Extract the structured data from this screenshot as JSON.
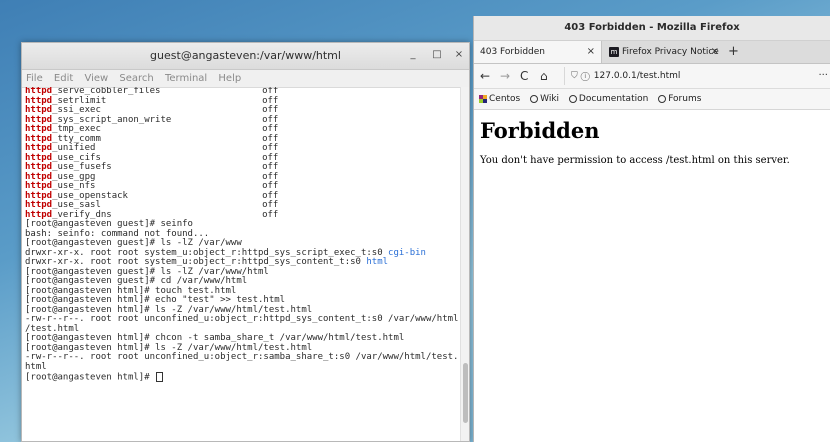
{
  "terminal": {
    "title": "guest@angasteven:/var/www/html",
    "menu": [
      "File",
      "Edit",
      "View",
      "Search",
      "Terminal",
      "Help"
    ],
    "controls": {
      "minimize": "_",
      "maximize": "□",
      "close": "×"
    },
    "bool_rows": [
      {
        "prefix": "httpd",
        "name": "_serve_cobbler_files",
        "value": "off"
      },
      {
        "prefix": "httpd",
        "name": "_setrlimit",
        "value": "off"
      },
      {
        "prefix": "httpd",
        "name": "_ssi_exec",
        "value": "off"
      },
      {
        "prefix": "httpd",
        "name": "_sys_script_anon_write",
        "value": "off"
      },
      {
        "prefix": "httpd",
        "name": "_tmp_exec",
        "value": "off"
      },
      {
        "prefix": "httpd",
        "name": "_tty_comm",
        "value": "off"
      },
      {
        "prefix": "httpd",
        "name": "_unified",
        "value": "off"
      },
      {
        "prefix": "httpd",
        "name": "_use_cifs",
        "value": "off"
      },
      {
        "prefix": "httpd",
        "name": "_use_fusefs",
        "value": "off"
      },
      {
        "prefix": "httpd",
        "name": "_use_gpg",
        "value": "off"
      },
      {
        "prefix": "httpd",
        "name": "_use_nfs",
        "value": "off"
      },
      {
        "prefix": "httpd",
        "name": "_use_openstack",
        "value": "off"
      },
      {
        "prefix": "httpd",
        "name": "_use_sasl",
        "value": "off"
      },
      {
        "prefix": "httpd",
        "name": "_verify_dns",
        "value": "off"
      }
    ],
    "lines": [
      "[root@angasteven guest]# seinfo",
      "bash: seinfo: command not found...",
      "[root@angasteven guest]# ls -lZ /var/www"
    ],
    "ls_rows": [
      {
        "text": "drwxr-xr-x. root root system_u:object_r:httpd_sys_script_exec_t:s0 ",
        "dir": "cgi-bin"
      },
      {
        "text": "drwxr-xr-x. root root system_u:object_r:httpd_sys_content_t:s0 ",
        "dir": "html"
      }
    ],
    "lines2": [
      "[root@angasteven guest]# ls -lZ /var/www/html",
      "[root@angasteven guest]# cd /var/www/html",
      "[root@angasteven html]# touch test.html",
      "[root@angasteven html]# echo \"test\" >> test.html",
      "[root@angasteven html]# ls -Z /var/www/html/test.html",
      "-rw-r--r--. root root unconfined_u:object_r:httpd_sys_content_t:s0 /var/www/html",
      "/test.html",
      "[root@angasteven html]# chcon -t samba_share_t /var/www/html/test.html",
      "[root@angasteven html]# ls -Z /var/www/html/test.html",
      "-rw-r--r--. root root unconfined_u:object_r:samba_share_t:s0 /var/www/html/test.",
      "html"
    ],
    "prompt": "[root@angasteven html]# "
  },
  "firefox": {
    "title": "403 Forbidden - Mozilla Firefox",
    "tabs": [
      {
        "label": "403 Forbidden",
        "close": "×"
      },
      {
        "label": "Firefox Privacy Notice —",
        "close": "×",
        "icon": "m"
      }
    ],
    "new_tab": "+",
    "nav": {
      "back": "←",
      "forward": "→",
      "reload": "C",
      "home": "⌂"
    },
    "url": "127.0.0.1/test.html",
    "url_menu": "···",
    "bookmarks": [
      "Centos",
      "Wiki",
      "Documentation",
      "Forums"
    ],
    "page": {
      "heading": "Forbidden",
      "message": "You don't have permission to access /test.html on this server."
    }
  }
}
